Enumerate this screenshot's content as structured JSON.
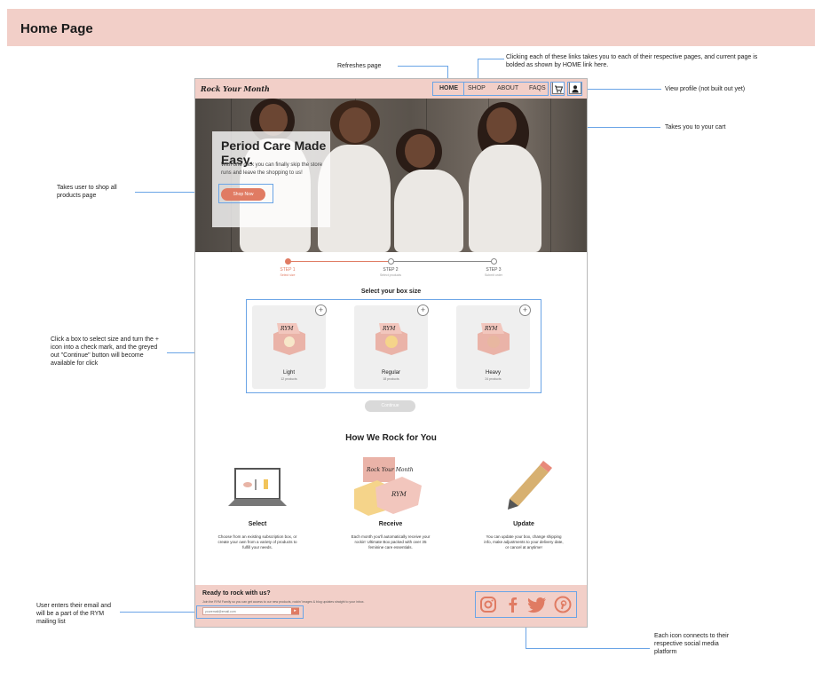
{
  "banner": {
    "title": "Home Page"
  },
  "annotations": {
    "refresh": "Refreshes page",
    "links": "Clicking each of these links takes you to each  of their respective pages, and current page is bolded as shown by HOME link here.",
    "profile": "View profile (not built out yet)",
    "cart": "Takes you to your cart",
    "shop_all": "Takes user to shop all products page",
    "box_select": "Click a box to select size and turn the + icon into a check mark, and the greyed out \"Continue\" button will become available for click",
    "email": "User enters their email and will be a part of the RYM mailing list",
    "social": "Each icon connects to their respective social media platform"
  },
  "site": {
    "logo": "Rock Your Month",
    "nav": {
      "home": "HOME",
      "shop": "SHOP",
      "about": "ABOUT",
      "faqs": "FAQS",
      "cart_icon": "cart-icon",
      "profile_icon": "user-icon"
    },
    "hero": {
      "title": "Period Care Made Easy.",
      "text": "With one click you can finally skip the store runs and leave the shopping to us!",
      "button": "Shop Now"
    },
    "steps": [
      {
        "label": "STEP 1",
        "sub": "Select size"
      },
      {
        "label": "STEP 2",
        "sub": "Select products"
      },
      {
        "label": "STEP 3",
        "sub": "Submit order"
      }
    ],
    "box_section": {
      "title": "Select your box size",
      "boxes": [
        {
          "name": "Light",
          "sub": "12 products"
        },
        {
          "name": "Regular",
          "sub": "18 products"
        },
        {
          "name": "Heavy",
          "sub": "24 products"
        }
      ],
      "continue": "Continue"
    },
    "how": {
      "title": "How We Rock for You",
      "columns": [
        {
          "title": "Select",
          "text": "Choose from an existing subscription box, or create your own from a variety of products to fulfill your needs."
        },
        {
          "title": "Receive",
          "text": "Each month you'll automatically receive your rockin' Ultimate Box packed with over 35 feminine care essentials."
        },
        {
          "title": "Update",
          "text": "You can update your box, change shipping info, make adjustments to your delivery date, or cancel at anytime!"
        }
      ]
    },
    "footer": {
      "title": "Ready to rock with us?",
      "text": "Join the RYM Family so you can get access to our new products, rockin' images & blog updates straight to your inbox.",
      "email_placeholder": "youremail@email.com",
      "social_icons": [
        "instagram-icon",
        "facebook-icon",
        "twitter-icon",
        "pinterest-icon"
      ]
    }
  }
}
